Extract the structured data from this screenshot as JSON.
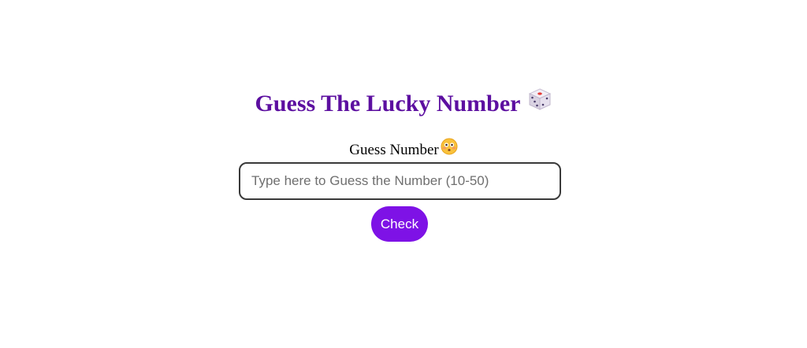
{
  "header": {
    "title": "Guess The Lucky Number",
    "title_icon": "game-die-icon",
    "title_color": "#5c0fa0"
  },
  "form": {
    "label": "Guess Number",
    "label_icon": "flushed-face-icon",
    "input_value": "",
    "input_placeholder": "Type here to Guess the Number (10-50)",
    "check_label": "Check",
    "button_color": "#7e12e6"
  }
}
